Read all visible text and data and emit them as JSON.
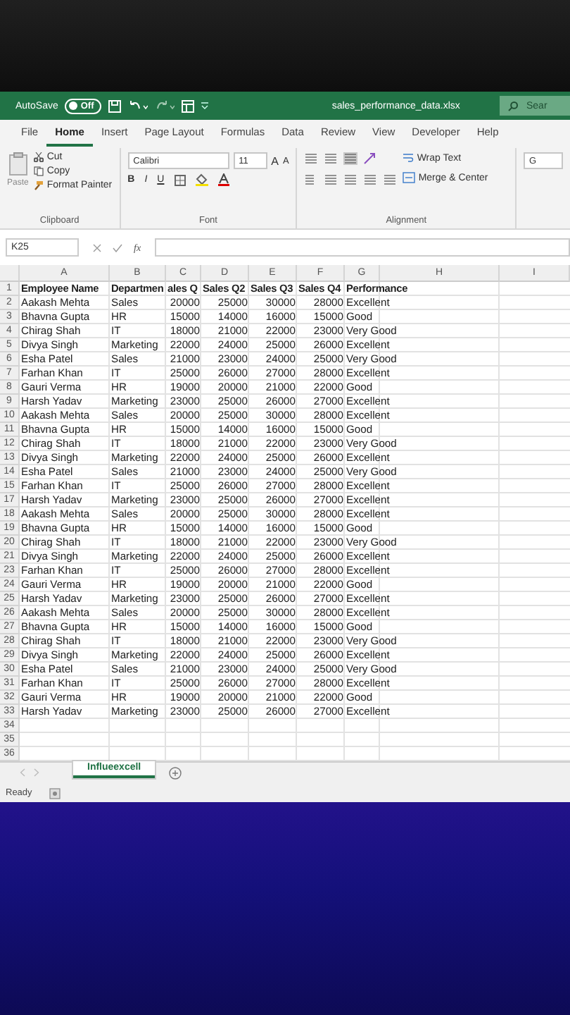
{
  "window": {
    "autosave_label": "AutoSave",
    "autosave_state": "Off",
    "title": "sales_performance_data.xlsx",
    "search_placeholder": "Sear"
  },
  "menu_tabs": [
    {
      "label": "File",
      "selected": false
    },
    {
      "label": "Home",
      "selected": true
    },
    {
      "label": "Insert",
      "selected": false
    },
    {
      "label": "Page Layout",
      "selected": false
    },
    {
      "label": "Formulas",
      "selected": false
    },
    {
      "label": "Data",
      "selected": false
    },
    {
      "label": "Review",
      "selected": false
    },
    {
      "label": "View",
      "selected": false
    },
    {
      "label": "Developer",
      "selected": false
    },
    {
      "label": "Help",
      "selected": false
    }
  ],
  "ribbon": {
    "clipboard": {
      "paste": "Paste",
      "cut": "Cut",
      "copy": "Copy",
      "format_painter": "Format Painter",
      "label": "Clipboard"
    },
    "font": {
      "name": "Calibri",
      "size": "11",
      "grow": "A",
      "shrink": "A",
      "bold": "B",
      "italic": "I",
      "underline": "U",
      "label": "Font"
    },
    "alignment": {
      "wrap": "Wrap Text",
      "merge": "Merge & Center",
      "label": "Alignment"
    },
    "number_format": "G"
  },
  "formula_bar": {
    "name_box": "K25",
    "function_label": "fx"
  },
  "sheet": {
    "columns": [
      "A",
      "B",
      "C",
      "D",
      "E",
      "F",
      "G",
      "H",
      "I"
    ],
    "rows": [
      {
        "number": "1",
        "cells": [
          "Employee Name",
          "Departmen",
          "ales Q",
          "Sales Q2",
          "Sales Q3",
          "Sales Q4",
          "Performance"
        ]
      },
      {
        "number": "2",
        "cells": [
          "Aakash Mehta",
          "Sales",
          "20000",
          "25000",
          "30000",
          "28000",
          "Excellent"
        ]
      },
      {
        "number": "3",
        "cells": [
          "Bhavna Gupta",
          "HR",
          "15000",
          "14000",
          "16000",
          "15000",
          "Good"
        ]
      },
      {
        "number": "4",
        "cells": [
          "Chirag Shah",
          "IT",
          "18000",
          "21000",
          "22000",
          "23000",
          "Very Good"
        ]
      },
      {
        "number": "5",
        "cells": [
          "Divya Singh",
          "Marketing",
          "22000",
          "24000",
          "25000",
          "26000",
          "Excellent"
        ]
      },
      {
        "number": "6",
        "cells": [
          "Esha Patel",
          "Sales",
          "21000",
          "23000",
          "24000",
          "25000",
          "Very Good"
        ]
      },
      {
        "number": "7",
        "cells": [
          "Farhan Khan",
          "IT",
          "25000",
          "26000",
          "27000",
          "28000",
          "Excellent"
        ]
      },
      {
        "number": "8",
        "cells": [
          "Gauri Verma",
          "HR",
          "19000",
          "20000",
          "21000",
          "22000",
          "Good"
        ]
      },
      {
        "number": "9",
        "cells": [
          "Harsh Yadav",
          "Marketing",
          "23000",
          "25000",
          "26000",
          "27000",
          "Excellent"
        ]
      },
      {
        "number": "10",
        "cells": [
          "Aakash Mehta",
          "Sales",
          "20000",
          "25000",
          "30000",
          "28000",
          "Excellent"
        ]
      },
      {
        "number": "11",
        "cells": [
          "Bhavna Gupta",
          "HR",
          "15000",
          "14000",
          "16000",
          "15000",
          "Good"
        ]
      },
      {
        "number": "12",
        "cells": [
          "Chirag Shah",
          "IT",
          "18000",
          "21000",
          "22000",
          "23000",
          "Very Good"
        ]
      },
      {
        "number": "13",
        "cells": [
          "Divya Singh",
          "Marketing",
          "22000",
          "24000",
          "25000",
          "26000",
          "Excellent"
        ]
      },
      {
        "number": "14",
        "cells": [
          "Esha Patel",
          "Sales",
          "21000",
          "23000",
          "24000",
          "25000",
          "Very Good"
        ]
      },
      {
        "number": "15",
        "cells": [
          "Farhan Khan",
          "IT",
          "25000",
          "26000",
          "27000",
          "28000",
          "Excellent"
        ]
      },
      {
        "number": "17",
        "cells": [
          "Harsh Yadav",
          "Marketing",
          "23000",
          "25000",
          "26000",
          "27000",
          "Excellent"
        ]
      },
      {
        "number": "18",
        "cells": [
          "Aakash Mehta",
          "Sales",
          "20000",
          "25000",
          "30000",
          "28000",
          "Excellent"
        ]
      },
      {
        "number": "19",
        "cells": [
          "Bhavna Gupta",
          "HR",
          "15000",
          "14000",
          "16000",
          "15000",
          "Good"
        ]
      },
      {
        "number": "20",
        "cells": [
          "Chirag Shah",
          "IT",
          "18000",
          "21000",
          "22000",
          "23000",
          "Very Good"
        ]
      },
      {
        "number": "21",
        "cells": [
          "Divya Singh",
          "Marketing",
          "22000",
          "24000",
          "25000",
          "26000",
          "Excellent"
        ]
      },
      {
        "number": "23",
        "cells": [
          "Farhan Khan",
          "IT",
          "25000",
          "26000",
          "27000",
          "28000",
          "Excellent"
        ]
      },
      {
        "number": "24",
        "cells": [
          "Gauri Verma",
          "HR",
          "19000",
          "20000",
          "21000",
          "22000",
          "Good"
        ]
      },
      {
        "number": "25",
        "cells": [
          "Harsh Yadav",
          "Marketing",
          "23000",
          "25000",
          "26000",
          "27000",
          "Excellent"
        ]
      },
      {
        "number": "26",
        "cells": [
          "Aakash Mehta",
          "Sales",
          "20000",
          "25000",
          "30000",
          "28000",
          "Excellent"
        ]
      },
      {
        "number": "27",
        "cells": [
          "Bhavna Gupta",
          "HR",
          "15000",
          "14000",
          "16000",
          "15000",
          "Good"
        ]
      },
      {
        "number": "28",
        "cells": [
          "Chirag Shah",
          "IT",
          "18000",
          "21000",
          "22000",
          "23000",
          "Very Good"
        ]
      },
      {
        "number": "29",
        "cells": [
          "Divya Singh",
          "Marketing",
          "22000",
          "24000",
          "25000",
          "26000",
          "Excellent"
        ]
      },
      {
        "number": "30",
        "cells": [
          "Esha Patel",
          "Sales",
          "21000",
          "23000",
          "24000",
          "25000",
          "Very Good"
        ]
      },
      {
        "number": "31",
        "cells": [
          "Farhan Khan",
          "IT",
          "25000",
          "26000",
          "27000",
          "28000",
          "Excellent"
        ]
      },
      {
        "number": "32",
        "cells": [
          "Gauri Verma",
          "HR",
          "19000",
          "20000",
          "21000",
          "22000",
          "Good"
        ]
      },
      {
        "number": "33",
        "cells": [
          "Harsh Yadav",
          "Marketing",
          "23000",
          "25000",
          "26000",
          "27000",
          "Excellent"
        ]
      },
      {
        "number": "34",
        "cells": []
      },
      {
        "number": "35",
        "cells": []
      },
      {
        "number": "36",
        "cells": []
      }
    ]
  },
  "sheet_tabs": [
    {
      "label": "Influeexcell",
      "selected": true
    }
  ],
  "status_bar": {
    "text": "Ready"
  }
}
